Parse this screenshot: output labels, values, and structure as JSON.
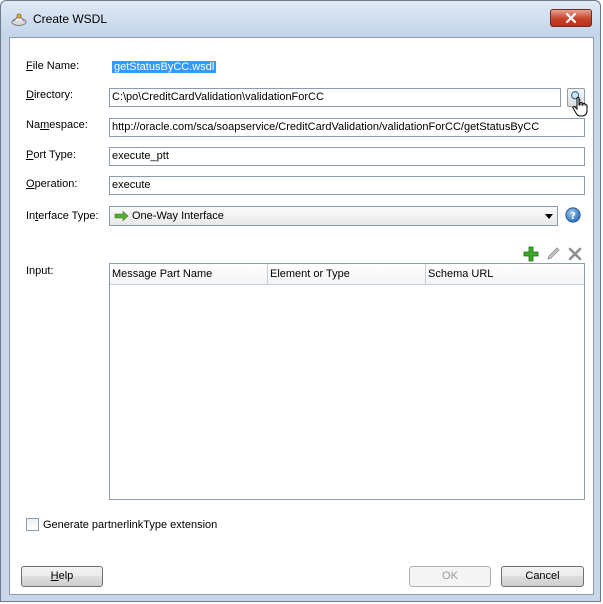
{
  "window": {
    "title": "Create WSDL"
  },
  "form": {
    "file_name": {
      "label_mnemonic": "F",
      "label_rest": "ile Name:",
      "value": "getStatusByCC.wsdl"
    },
    "directory": {
      "label_mnemonic": "D",
      "label_rest": "irectory:",
      "value": "C:\\po\\CreditCardValidation\\validationForCC"
    },
    "namespace": {
      "label_pre": "Na",
      "label_mnemonic": "m",
      "label_rest": "espace:",
      "value": "http://oracle.com/sca/soapservice/CreditCardValidation/validationForCC/getStatusByCC"
    },
    "port_type": {
      "label_mnemonic": "P",
      "label_rest": "ort Type:",
      "value": "execute_ptt"
    },
    "operation": {
      "label_mnemonic": "O",
      "label_rest": "peration:",
      "value": "execute"
    },
    "interface_type": {
      "label_pre": "In",
      "label_mnemonic": "t",
      "label_rest": "erface Type:",
      "value": "One-Way Interface"
    }
  },
  "input": {
    "label": "Input:",
    "columns": [
      "Message Part Name",
      "Element or Type",
      "Schema URL"
    ],
    "rows": []
  },
  "options": {
    "partnerlink_label": "Generate partnerlinkType extension",
    "partnerlink_checked": false
  },
  "buttons": {
    "help_mnemonic": "H",
    "help_rest": "elp",
    "ok": "OK",
    "cancel": "Cancel"
  },
  "icons": {
    "app": "wsdl-icon",
    "browse": "browse-icon",
    "add": "add-icon",
    "edit": "edit-icon",
    "delete": "delete-icon",
    "help": "help-icon",
    "interface": "one-way-arrow-icon"
  }
}
